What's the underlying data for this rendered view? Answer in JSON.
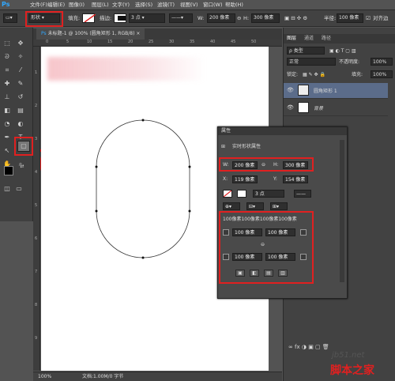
{
  "app": {
    "logo": "Ps"
  },
  "menu": [
    "文件(F)",
    "编辑(E)",
    "图像(I)",
    "图层(L)",
    "文字(Y)",
    "选择(S)",
    "滤镜(T)",
    "视图(V)",
    "窗口(W)",
    "帮助(H)"
  ],
  "options": {
    "mode_value": "形状",
    "fill_label": "填充:",
    "stroke_label": "描边:",
    "stroke_width": "3 点",
    "w_label": "W:",
    "w_value": "200 像素",
    "h_label": "H:",
    "h_value": "300 像素",
    "radius_label": "半径:",
    "radius_value": "100 像素",
    "align_label": "对齐边"
  },
  "document": {
    "tab_title": "未标题-1 @ 100% (圆角矩形 1, RGB/8)",
    "zoom": "100%",
    "status": "文档:1.00M/0 字节",
    "ruler_ticks_top": [
      "0",
      "5",
      "10",
      "15",
      "20",
      "25",
      "30",
      "35",
      "40",
      "45",
      "50"
    ],
    "ruler_ticks_left": [
      "1",
      "2",
      "3",
      "4",
      "5",
      "6",
      "7",
      "8",
      "9"
    ]
  },
  "layers_panel": {
    "tabs": [
      "图层",
      "通道",
      "路径"
    ],
    "kind_label": "ρ 类型",
    "blend_mode": "正常",
    "opacity_label": "不透明度:",
    "opacity_value": "100%",
    "lock_label": "锁定:",
    "fill_label": "填充:",
    "fill_value": "100%",
    "layers": [
      {
        "name": "圆角矩形 1",
        "selected": true
      },
      {
        "name": "背景",
        "selected": false
      }
    ]
  },
  "properties_panel": {
    "title": "属性",
    "subtitle": "实时形状属性",
    "w_label": "W:",
    "w_value": "200 像素",
    "h_label": "H:",
    "h_value": "300 像素",
    "x_label": "X:",
    "x_value": "119 像素",
    "y_label": "Y:",
    "y_value": "154 像素",
    "stroke_width": "3 点",
    "corner_summary": "100像素100像素100像素100像素",
    "corner_tl": "100 像素",
    "corner_tr": "100 像素",
    "corner_bl": "100 像素",
    "corner_br": "100 像素"
  },
  "watermark": {
    "site": "jb51.net",
    "name": "脚本之家"
  },
  "colors": {
    "highlight": "#e02020",
    "accent": "#31a8ff"
  }
}
